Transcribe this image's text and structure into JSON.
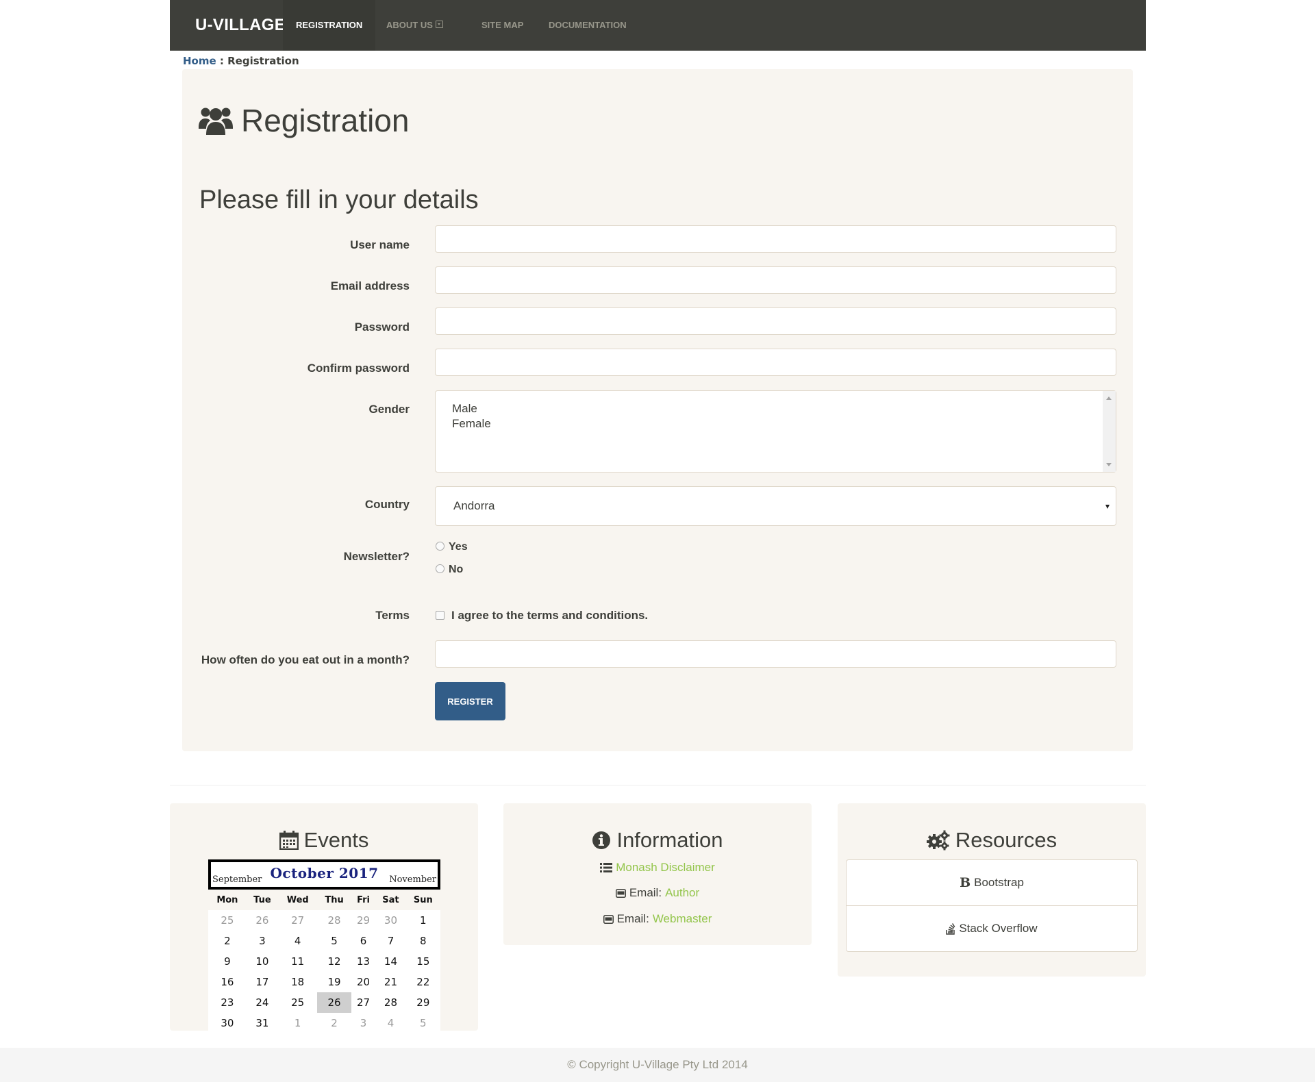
{
  "navbar": {
    "brand": "U-VILLAGE",
    "items": [
      "REGISTRATION",
      "ABOUT US",
      "SITE MAP",
      "DOCUMENTATION"
    ],
    "active": "REGISTRATION"
  },
  "breadcrumb": {
    "home": "Home",
    "separator": " : ",
    "current": "Registration"
  },
  "page": {
    "title": "Registration",
    "subtitle": "Please fill in your details"
  },
  "form": {
    "username_label": "User name",
    "email_label": "Email address",
    "password_label": "Password",
    "confirm_label": "Confirm password",
    "gender_label": "Gender",
    "gender_options": [
      "Male",
      "Female"
    ],
    "country_label": "Country",
    "country_value": "Andorra",
    "newsletter_label": "Newsletter?",
    "newsletter_options": [
      "Yes",
      "No"
    ],
    "terms_label": "Terms",
    "terms_text": "I agree to the terms and conditions.",
    "eatout_label": "How often do you eat out in a month?",
    "register_button": "REGISTER"
  },
  "events": {
    "title": "Events",
    "calendar": {
      "prev": "September",
      "current": "October 2017",
      "next": "November",
      "weekdays": [
        "Mon",
        "Tue",
        "Wed",
        "Thu",
        "Fri",
        "Sat",
        "Sun"
      ],
      "weeks": [
        [
          "25",
          "26",
          "27",
          "28",
          "29",
          "30",
          "1"
        ],
        [
          "2",
          "3",
          "4",
          "5",
          "6",
          "7",
          "8"
        ],
        [
          "9",
          "10",
          "11",
          "12",
          "13",
          "14",
          "15"
        ],
        [
          "16",
          "17",
          "18",
          "19",
          "20",
          "21",
          "22"
        ],
        [
          "23",
          "24",
          "25",
          "26",
          "27",
          "28",
          "29"
        ],
        [
          "30",
          "31",
          "1",
          "2",
          "3",
          "4",
          "5"
        ]
      ],
      "today": "26"
    }
  },
  "information": {
    "title": "Information",
    "disclaimer_link": "Monash Disclaimer",
    "email_prefix": "Email:",
    "author_link": "Author",
    "webmaster_link": "Webmaster"
  },
  "resources": {
    "title": "Resources",
    "items": [
      "Bootstrap",
      "Stack Overflow"
    ],
    "bootstrap_glyph": "B"
  },
  "footer": {
    "text": "© Copyright U-Village Pty Ltd 2014"
  },
  "colors": {
    "navbar": "#3e3f3a",
    "panel": "#f8f5f0",
    "primary": "#325d88",
    "link": "#93c54b",
    "calendar_month": "#1a237e"
  },
  "icons": {
    "title": "users-icon",
    "events": "calendar-icon",
    "information": "info-circle-icon",
    "resources": "gears-icon",
    "disclaimer": "list-icon",
    "email": "envelope-icon",
    "bootstrap": "bootstrap-icon",
    "stackoverflow": "stack-overflow-icon"
  }
}
